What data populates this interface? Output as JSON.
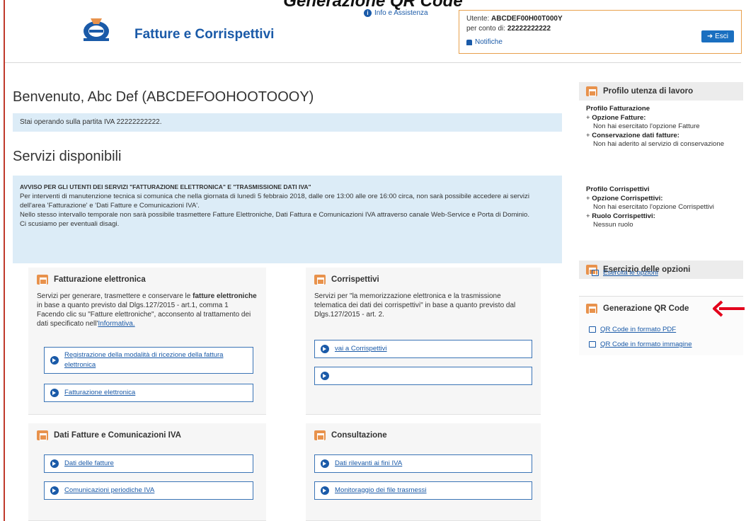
{
  "caption": "Generazione QR Code",
  "header": {
    "app_title": "Fatture e Corrispettivi",
    "info_link": "Info e Assistenza",
    "user_label": "Utente:",
    "user_value": "ABCDEF00H00T000Y",
    "for_label": "per conto di:",
    "for_value": "22222222222",
    "notifications": "Notifiche",
    "exit": "Esci"
  },
  "main": {
    "welcome": "Benvenuto, Abc Def (ABCDEFOOHOOTOOOY)",
    "partita": "Stai operando sulla partita IVA 22222222222.",
    "services_title": "Servizi disponibili",
    "notice_title": "AVVISO PER GLI UTENTI DEI SERVIZI \"FATTURAZIONE ELETTRONICA\" E \"TRASMISSIONE DATI IVA\"",
    "notice_body": "Per interventi di manutenzione tecnica si comunica che nella giornata di lunedì 5 febbraio 2018, dalle ore 13:00 alle ore 16:00 circa, non sarà possibile accedere ai servizi dell'area 'Fatturazione' e 'Dati Fatture e Comunicazioni IVA'.",
    "notice_body2": "Nello stesso intervallo temporale non sarà possibile trasmettere Fatture Elettroniche, Dati Fattura e Comunicazioni IVA attraverso canale Web-Service e Porta di Dominio.",
    "notice_body3": "Ci scusiamo per eventuali disagi."
  },
  "panels": {
    "fatturazione": {
      "title": "Fatturazione elettronica",
      "text1": "Servizi per generare, trasmettere e conservare le ",
      "text_bold": "fatture elettroniche",
      "text2": " in base a quanto previsto dal Dlgs.127/2015 - art.1, comma 1",
      "text3": "Facendo clic su \"Fatture elettroniche\", acconsento al trattamento dei dati specificato nell'",
      "informativa": "Informativa.",
      "link1": "Registrazione della modalità di ricezione della fattura elettronica",
      "link2": "Fatturazione elettronica"
    },
    "corrispettivi": {
      "title": "Corrispettivi",
      "text": "Servizi per \"la memorizzazione elettronica e la trasmissione telematica dei dati dei corrispettivi\" in base a quanto previsto dal Dlgs.127/2015 - art. 2.",
      "link1": "vai a Corrispettivi",
      "link2": ""
    },
    "dati_fatture": {
      "title": "Dati Fatture e Comunicazioni IVA",
      "link1": "Dati delle fatture",
      "link2": "Comunicazioni periodiche IVA"
    },
    "consultazione": {
      "title": "Consultazione",
      "link1": "Dati rilevanti ai fini IVA",
      "link2": "Monitoraggio dei file trasmessi"
    }
  },
  "sidebar": {
    "profilo_title": "Profilo utenza di lavoro",
    "profilo_fatt": "Profilo Fatturazione",
    "opzione_fatture": "Opzione Fatture:",
    "opzione_fatture_val": "Non hai esercitato l'opzione Fatture",
    "conservazione": "Conservazione dati fatture:",
    "conservazione_val": "Non hai aderito al servizio di conservazione",
    "profilo_corr": "Profilo Corrispettivi",
    "opzione_corr": "Opzione Corrispettivi:",
    "opzione_corr_val": "Non hai esercitato l'opzione Corrispettivi",
    "ruolo": "Ruolo Corrispettivi:",
    "ruolo_val": "Nessun ruolo",
    "esercizio_title": "Esercizio delle opzioni",
    "esercita_link": "Esercita le opzioni",
    "qr_title": "Generazione QR Code",
    "qr_pdf": "QR Code in formato PDF",
    "qr_img": "QR Code in formato immagine"
  },
  "colors": {
    "accent": "#1a5aa8",
    "orange": "#e8924c",
    "arrow": "#e3001b"
  }
}
